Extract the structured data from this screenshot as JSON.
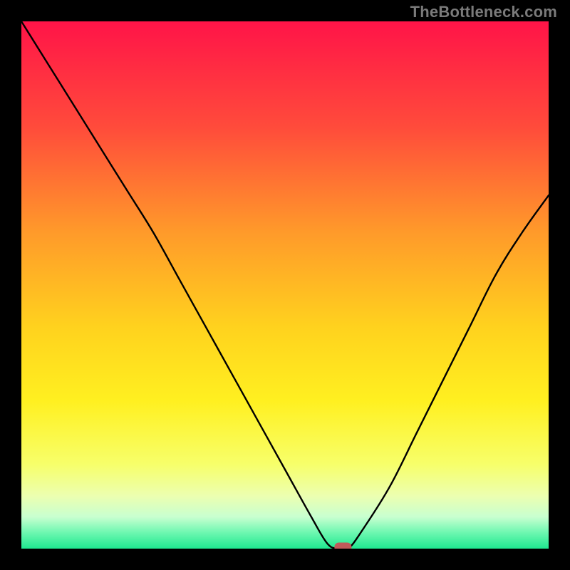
{
  "watermark": "TheBottleneck.com",
  "chart_data": {
    "type": "line",
    "title": "",
    "xlabel": "",
    "ylabel": "",
    "xlim": [
      0,
      100
    ],
    "ylim": [
      0,
      100
    ],
    "x": [
      0,
      5,
      10,
      15,
      20,
      25,
      30,
      35,
      40,
      45,
      50,
      55,
      58,
      60,
      62,
      65,
      70,
      75,
      80,
      85,
      90,
      95,
      100
    ],
    "y": [
      100,
      92,
      84,
      76,
      68,
      60,
      51,
      42,
      33,
      24,
      15,
      6,
      1,
      0,
      0,
      4,
      12,
      22,
      32,
      42,
      52,
      60,
      67
    ],
    "marker": {
      "x": 61,
      "y": 0
    },
    "gradient_stops": [
      {
        "offset": 0.0,
        "color": "#ff1448"
      },
      {
        "offset": 0.2,
        "color": "#ff4b3b"
      },
      {
        "offset": 0.4,
        "color": "#ff9a2a"
      },
      {
        "offset": 0.58,
        "color": "#ffd21e"
      },
      {
        "offset": 0.72,
        "color": "#fff020"
      },
      {
        "offset": 0.84,
        "color": "#f7ff6a"
      },
      {
        "offset": 0.9,
        "color": "#ecffb0"
      },
      {
        "offset": 0.94,
        "color": "#c8ffd0"
      },
      {
        "offset": 0.97,
        "color": "#6cf7b0"
      },
      {
        "offset": 1.0,
        "color": "#1fe890"
      }
    ]
  }
}
